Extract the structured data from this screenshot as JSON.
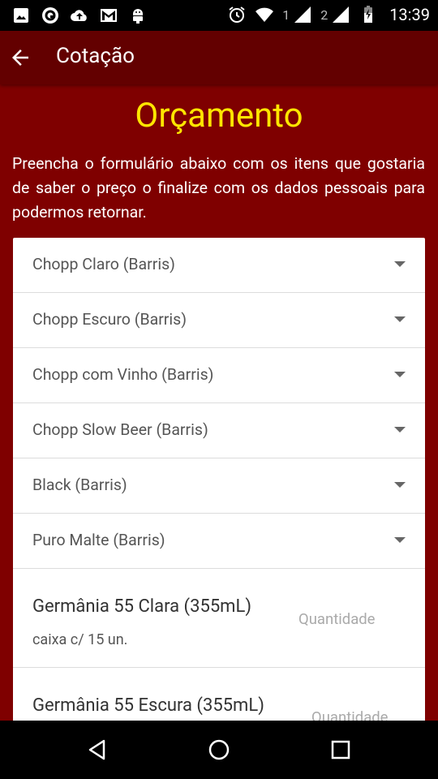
{
  "status_bar": {
    "sim1": "1",
    "sim2": "2",
    "time": "13:39"
  },
  "app_bar": {
    "title": "Cotação",
    "back_icon": "arrow-back-icon"
  },
  "page": {
    "heading": "Orçamento",
    "intro": "Preencha o formulário abaixo com os itens que gostaria de saber o preço o finalize com os dados pessoais para podermos retornar."
  },
  "form": {
    "selects": [
      {
        "label": "Chopp Claro (Barris)"
      },
      {
        "label": "Chopp Escuro (Barris)"
      },
      {
        "label": "Chopp com Vinho (Barris)"
      },
      {
        "label": "Chopp Slow Beer (Barris)"
      },
      {
        "label": "Black (Barris)"
      },
      {
        "label": "Puro Malte (Barris)"
      }
    ],
    "products": [
      {
        "name": "Germânia 55 Clara (355mL)",
        "unit": "caixa c/ 15 un.",
        "qty_placeholder": "Quantidade"
      },
      {
        "name": "Germânia 55 Escura (355mL)",
        "unit": "",
        "qty_placeholder": "Quantidade"
      }
    ]
  },
  "colors": {
    "background": "#7f0000",
    "app_bar": "#630000",
    "heading": "#ffe600"
  }
}
